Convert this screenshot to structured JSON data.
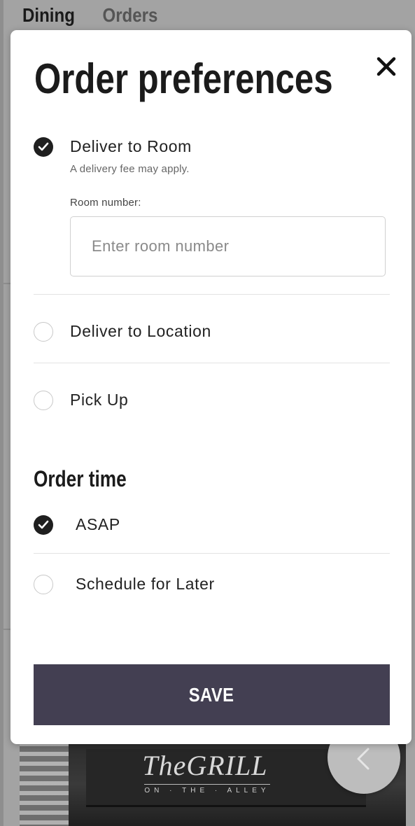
{
  "background": {
    "tabs": [
      {
        "label": "Dining",
        "active": true
      },
      {
        "label": "Orders",
        "active": false
      }
    ],
    "logo": {
      "main": "TheGRILL",
      "sub": "ON · THE · ALLEY"
    },
    "fab_icon": "chevron-left-icon"
  },
  "modal": {
    "title": "Order preferences",
    "close_icon": "close-icon",
    "delivery_options": [
      {
        "label": "Deliver to Room",
        "checked": true,
        "note": "A delivery fee may apply."
      },
      {
        "label": "Deliver to Location",
        "checked": false
      },
      {
        "label": "Pick Up",
        "checked": false
      }
    ],
    "room_field": {
      "label": "Room number:",
      "placeholder": "Enter room number",
      "value": ""
    },
    "order_time": {
      "title": "Order time",
      "options": [
        {
          "label": "ASAP",
          "checked": true
        },
        {
          "label": "Schedule for Later",
          "checked": false
        }
      ]
    },
    "save_label": "SAVE"
  },
  "colors": {
    "primary_button": "#433f52",
    "checked_radio": "#1f1f1f",
    "overlay": "#a3a3a3"
  }
}
